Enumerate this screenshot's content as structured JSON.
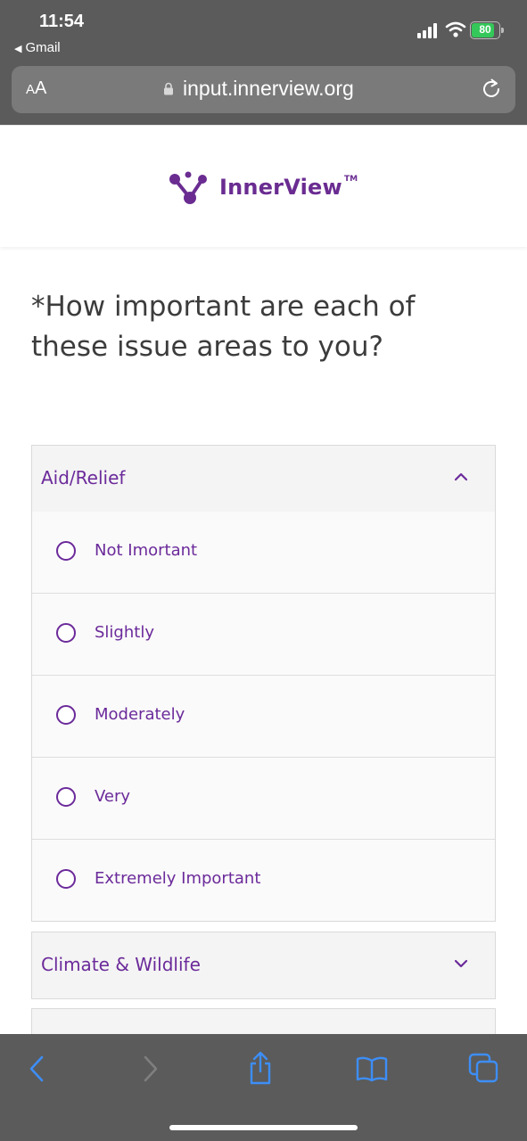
{
  "status_bar": {
    "time": "11:54",
    "back_app": "Gmail",
    "battery": "80"
  },
  "url_bar": {
    "aa_small": "A",
    "aa_big": "A",
    "url": "input.innerview.org"
  },
  "site": {
    "logo_text": "InnerView",
    "logo_tm": "TM",
    "brand_color": "#6a2c91"
  },
  "question": "*How important are each of these issue areas to you?",
  "sections": [
    {
      "title": "Aid/Relief",
      "expanded": true,
      "options": [
        "Not Imortant",
        "Slightly",
        "Moderately",
        "Very",
        "Extremely Important"
      ]
    },
    {
      "title": "Climate & Wildlife",
      "expanded": false
    }
  ],
  "icons": {
    "back": "chevron-left-icon",
    "forward": "chevron-right-icon",
    "share": "share-icon",
    "bookmarks": "book-icon",
    "tabs": "tabs-icon"
  }
}
